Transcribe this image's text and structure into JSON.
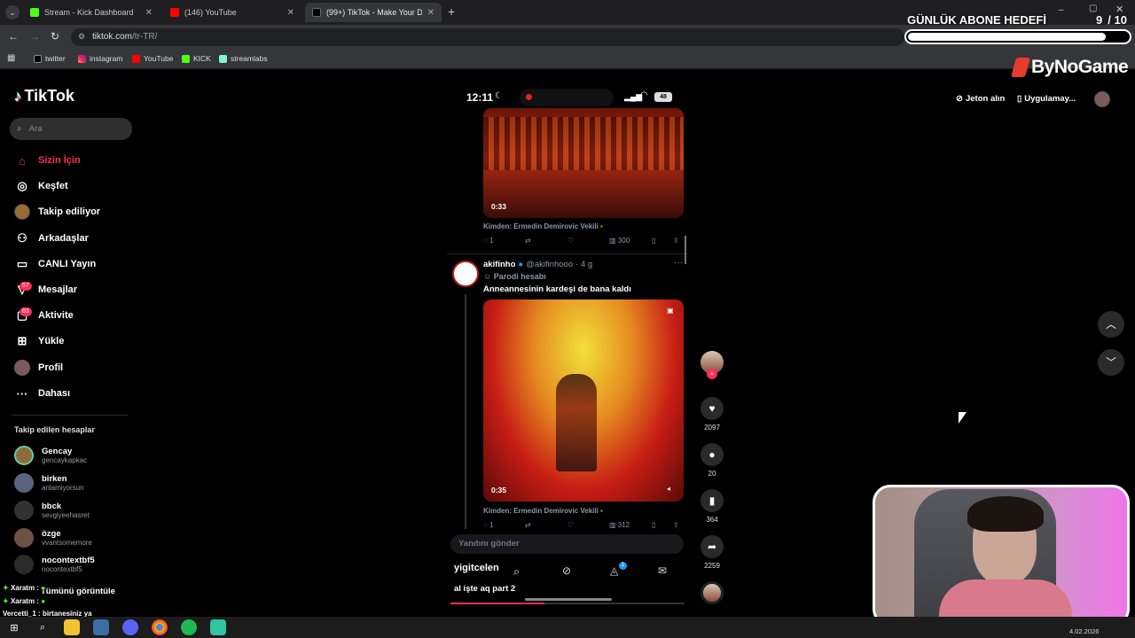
{
  "browser": {
    "tabs": [
      {
        "label": "Stream - Kick Dashboard",
        "color": "#53fc18"
      },
      {
        "label": "(146) YouTube",
        "color": "#ff0000"
      },
      {
        "label": "(99+) TikTok - Make Your Da",
        "color": "#ffffff"
      }
    ],
    "url_host": "tiktok.com",
    "url_path": "/tr-TR/",
    "bookmarks": [
      "twitter",
      "instagram",
      "YouTube",
      "KICK",
      "streamlabs"
    ]
  },
  "overlay": {
    "goal_title": "GÜNLÜK ABONE HEDEFİ",
    "goal_current": "9",
    "goal_total": "/ 10",
    "goal_progress": 0.9,
    "brand": "ByNoGame"
  },
  "tiktok": {
    "logo": "TikTok",
    "search_placeholder": "Ara",
    "nav": [
      {
        "label": "Sizin İçin",
        "icon": "home-icon",
        "active": true
      },
      {
        "label": "Keşfet",
        "icon": "compass-icon"
      },
      {
        "label": "Takip ediliyor",
        "icon": "following-avatar-icon"
      },
      {
        "label": "Arkadaşlar",
        "icon": "friends-icon"
      },
      {
        "label": "CANLI Yayın",
        "icon": "live-icon"
      },
      {
        "label": "Mesajlar",
        "icon": "message-icon",
        "badge": "57"
      },
      {
        "label": "Aktivite",
        "icon": "activity-icon",
        "badge": "63"
      },
      {
        "label": "Yükle",
        "icon": "upload-icon"
      },
      {
        "label": "Profil",
        "icon": "profile-icon"
      },
      {
        "label": "Dahası",
        "icon": "more-icon"
      }
    ],
    "following_title": "Takip edilen hesaplar",
    "following": [
      {
        "name": "Gencay",
        "user": "gencaykapkac"
      },
      {
        "name": "birken",
        "user": "anlamiyorsun"
      },
      {
        "name": "bbck",
        "user": "sevgiyeehasret"
      },
      {
        "name": "özge",
        "user": "vvantsomemore"
      },
      {
        "name": "nocontextbf5",
        "user": "nocontextbf5"
      }
    ],
    "see_all": "Tümünü görüntüle",
    "top_right": {
      "coins": "Jeton alın",
      "app": "Uygulamay..."
    }
  },
  "video": {
    "phone_time": "12:11",
    "battery": "48",
    "tweet1": {
      "duration": "0:33",
      "source": "Kimden: Ermedin Demirovic Vekili",
      "replies": "1",
      "views": "300"
    },
    "tweet2": {
      "name": "akifinho",
      "handle": "@akifinhooo",
      "age": "· 4 g",
      "parody": "Parodi hesabı",
      "text": "Anneannesinin kardeşi de bana kaldı",
      "duration": "0:35",
      "source": "Kimden: Ermedin Demirovic Vekili",
      "replies": "1",
      "views": "312"
    },
    "reply_placeholder": "Yanıtını gönder",
    "author": "yigitcelen",
    "caption": "al işte aq part 2",
    "likes": "2097",
    "comments": "20",
    "saves": "364",
    "shares": "2259",
    "notif_count": "1"
  },
  "chat": [
    {
      "user": "Xaratm :",
      "msg": ""
    },
    {
      "user": "Xaratm :",
      "msg": ""
    },
    {
      "user": "Vercetti_1 :",
      "msg": "birtanesiniz ya"
    }
  ],
  "taskbar": {
    "date": "4.02.2026"
  }
}
